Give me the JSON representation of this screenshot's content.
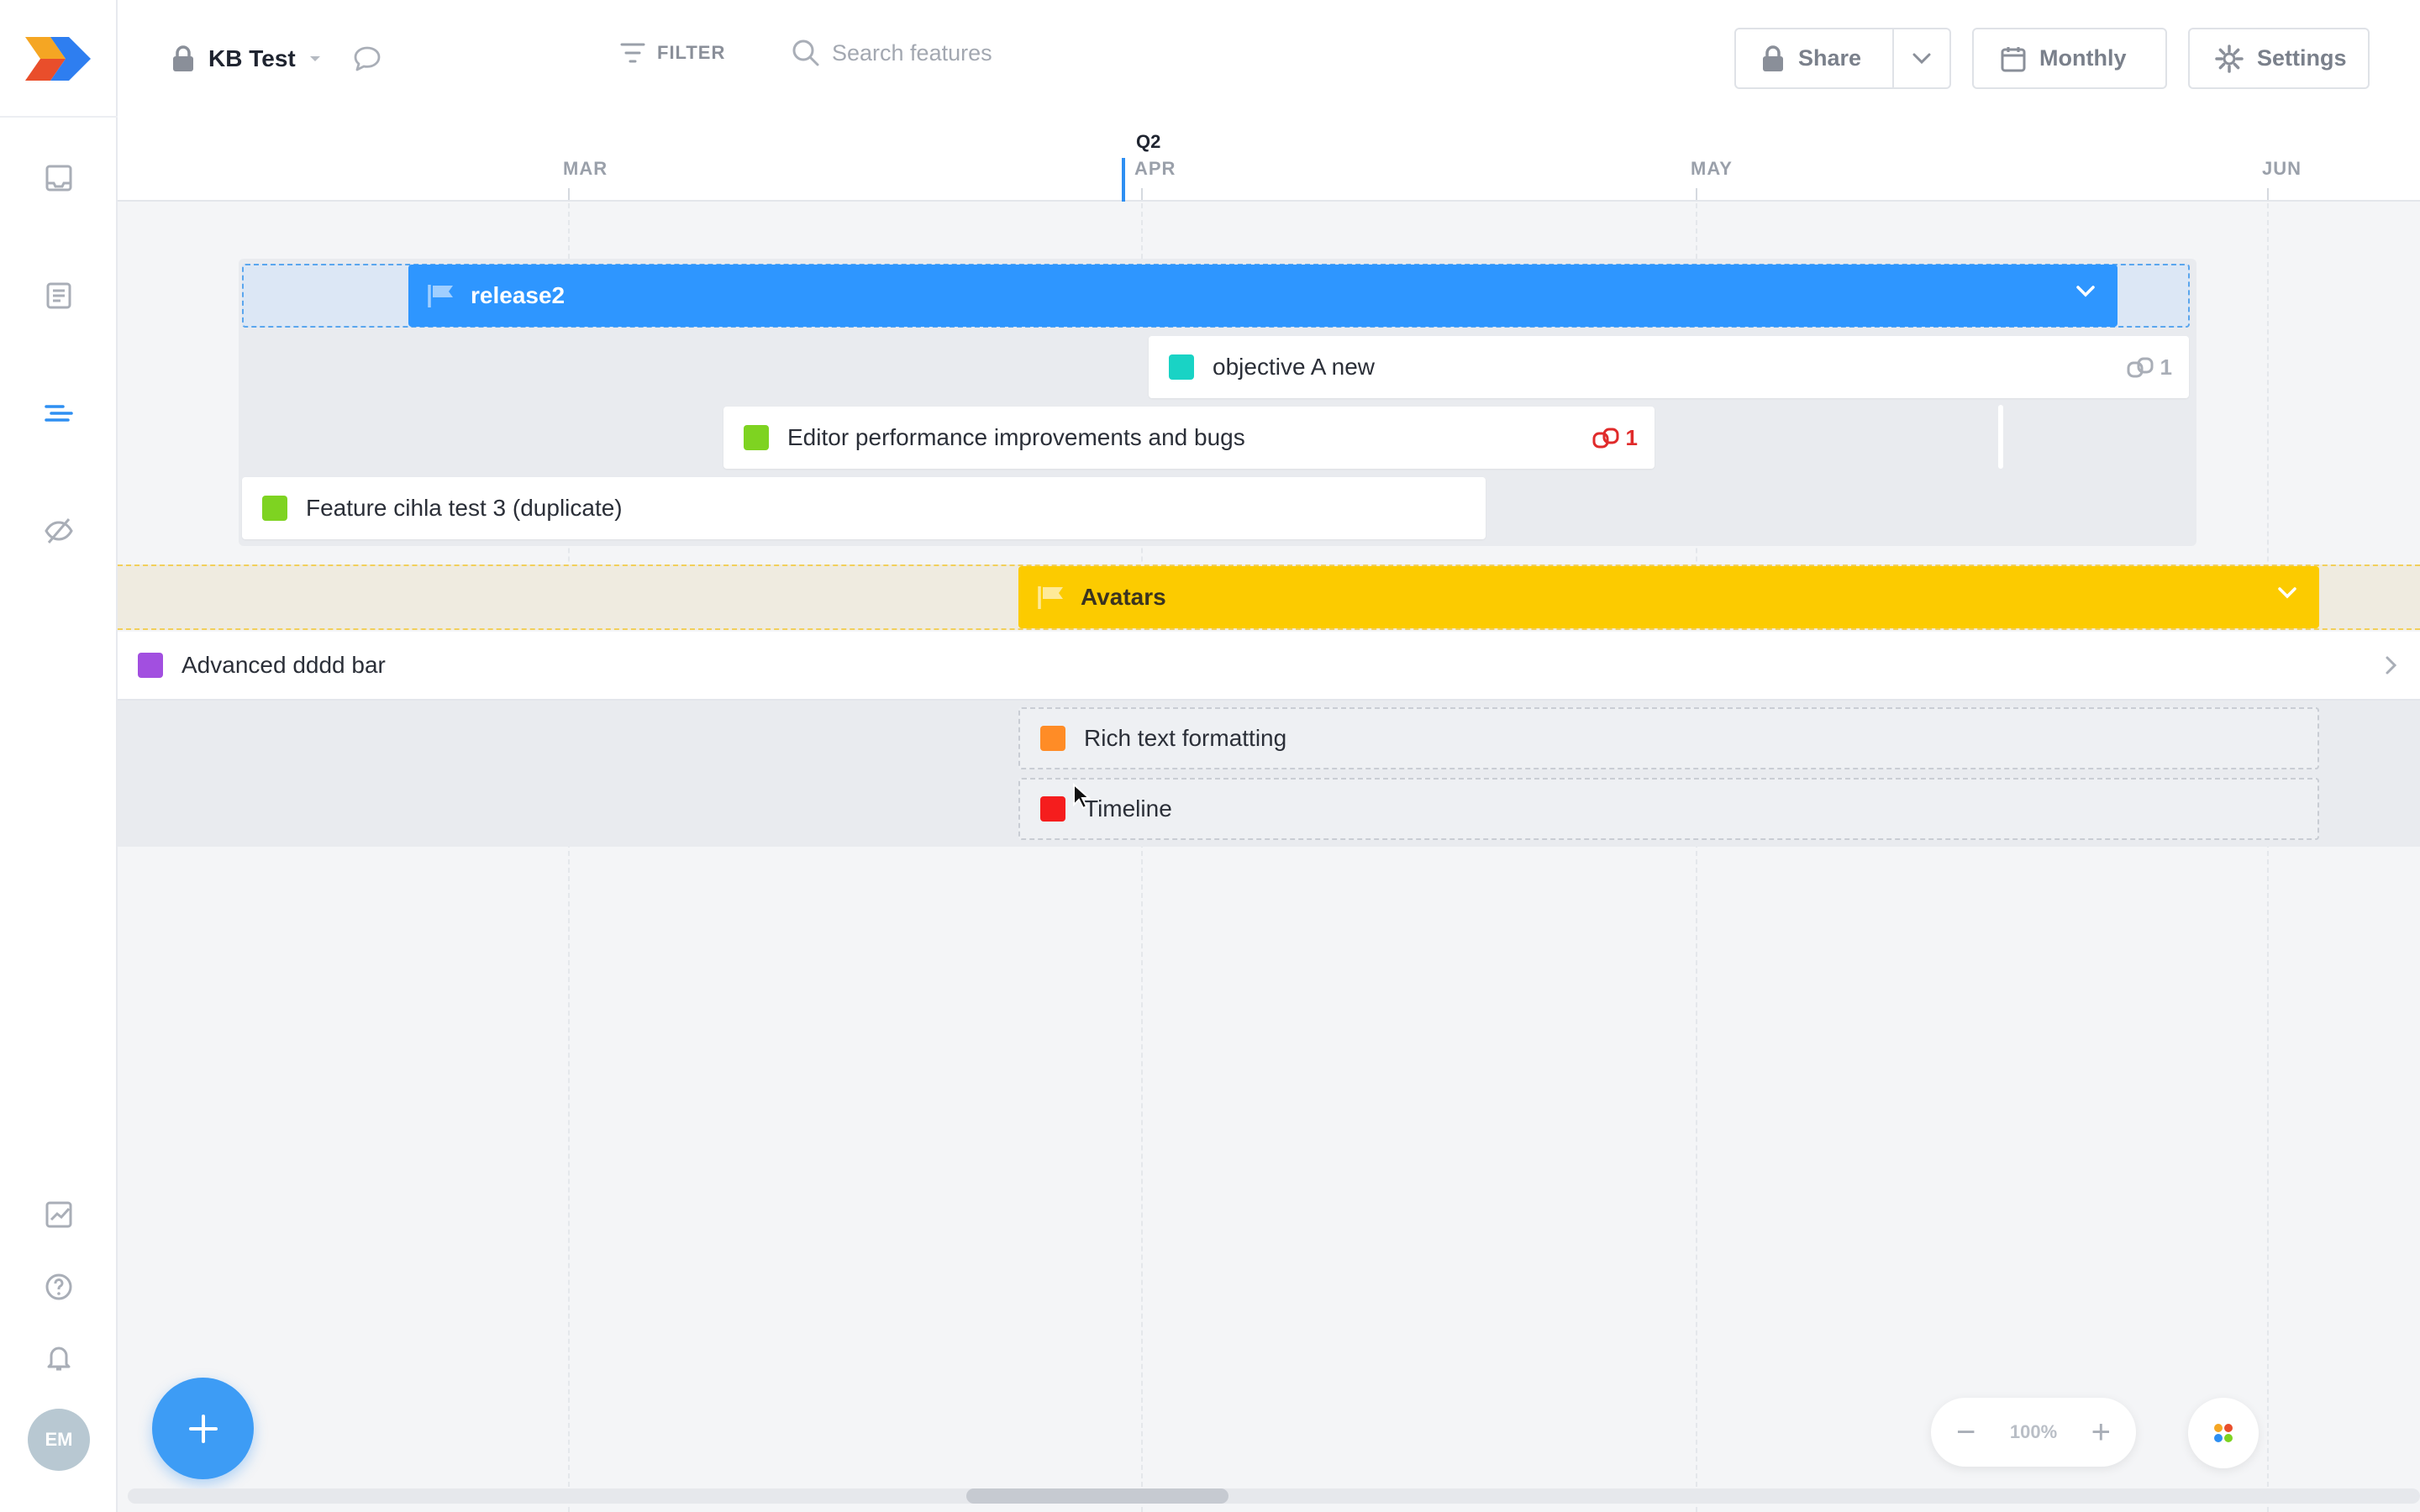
{
  "app": {
    "name": "Roadmap app",
    "logo_icon": "brand-logo-icon"
  },
  "sidebar": {
    "nav": [
      {
        "name": "inbox-icon"
      },
      {
        "name": "document-icon"
      },
      {
        "name": "timeline-icon",
        "active": true
      },
      {
        "name": "hidden-icon"
      }
    ],
    "bottom": [
      {
        "name": "analytics-icon"
      },
      {
        "name": "help-icon"
      },
      {
        "name": "bell-icon"
      }
    ],
    "avatar_initials": "EM"
  },
  "header": {
    "project_name": "KB Test",
    "filter_label": "FILTER",
    "search_placeholder": "Search features",
    "share_label": "Share",
    "view_label": "Monthly",
    "settings_label": "Settings"
  },
  "timeline": {
    "quarter": "Q2",
    "months": [
      "MAR",
      "APR",
      "MAY",
      "JUN"
    ]
  },
  "releases": [
    {
      "title": "release2",
      "color": "#2e96ff",
      "features": [
        {
          "title": "objective A new",
          "color": "#19d3c5",
          "badge": "1",
          "badge_color": "#a9aeb7"
        },
        {
          "title": "Editor performance improvements and bugs",
          "color": "#7ed321",
          "badge": "1",
          "badge_color": "#e02a2a"
        },
        {
          "title": "Feature cihla test 3 (duplicate)",
          "color": "#7ed321"
        }
      ]
    },
    {
      "title": "Avatars",
      "color": "#fccb00",
      "features": [
        {
          "title": "Advanced dddd bar",
          "color": "#a24fe0"
        },
        {
          "title": "Rich text formatting",
          "color": "#ff8c26"
        },
        {
          "title": "Timeline",
          "color": "#f51d1d"
        }
      ]
    }
  ],
  "zoom": {
    "level": "100%"
  }
}
